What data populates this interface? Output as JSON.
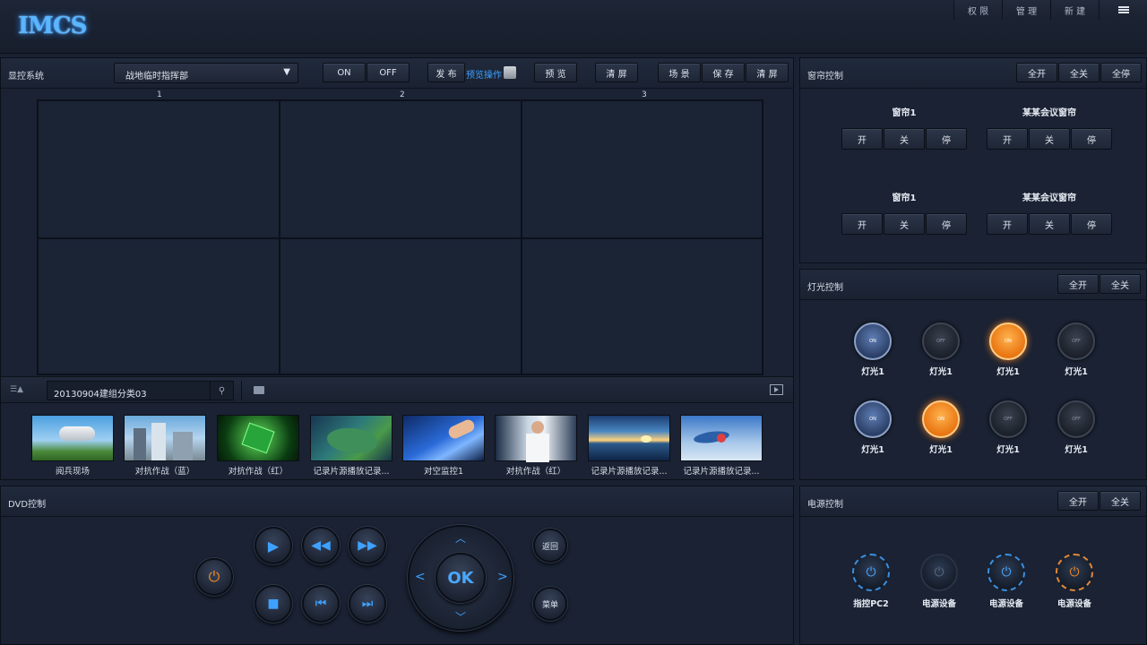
{
  "app": {
    "logo": "IMCS"
  },
  "topnav": [
    {
      "label": "权 限"
    },
    {
      "label": "管 理"
    },
    {
      "label": "新 建"
    }
  ],
  "display": {
    "title": "显控系统",
    "select_value": "战地临时指挥部",
    "on_label": "ON",
    "off_label": "OFF",
    "publish_label": "发 布",
    "preview_ops_label": "预览操作",
    "preview_label": "预 览",
    "clear_label": "清 屏",
    "scene_label": "场 景",
    "save_label": "保 存",
    "clear2_label": "清 屏",
    "columns": [
      "1",
      "2",
      "3"
    ],
    "search_value": "20130904建组分类03",
    "thumbnails": [
      {
        "label": "阅兵现场",
        "icon": "camera-scene"
      },
      {
        "label": "对抗作战（蓝）",
        "icon": "city-scene"
      },
      {
        "label": "对抗作战（红）",
        "icon": "chip-scene"
      },
      {
        "label": "记录片源播放记录...",
        "icon": "map-scene"
      },
      {
        "label": "对空监控1",
        "icon": "tablet-scene"
      },
      {
        "label": "对抗作战（红）",
        "icon": "doctor-scene"
      },
      {
        "label": "记录片源播放记录...",
        "icon": "sunset-scene"
      },
      {
        "label": "记录片源播放记录...",
        "icon": "particle-scene"
      }
    ]
  },
  "curtain": {
    "title": "窗帘控制",
    "all_open": "全开",
    "all_close": "全关",
    "all_stop": "全停",
    "groups": [
      {
        "name": "窗帘1",
        "open": "开",
        "close": "关",
        "stop": "停"
      },
      {
        "name": "某某会议窗帘",
        "open": "开",
        "close": "关",
        "stop": "停"
      },
      {
        "name": "窗帘1",
        "open": "开",
        "close": "关",
        "stop": "停"
      },
      {
        "name": "某某会议窗帘",
        "open": "开",
        "close": "关",
        "stop": "停"
      }
    ]
  },
  "light": {
    "title": "灯光控制",
    "all_open": "全开",
    "all_close": "全关",
    "lamps": [
      {
        "label": "灯光1",
        "state": "ON",
        "style": "on"
      },
      {
        "label": "灯光1",
        "state": "OFF",
        "style": "off"
      },
      {
        "label": "灯光1",
        "state": "ON",
        "style": "orange"
      },
      {
        "label": "灯光1",
        "state": "OFF",
        "style": "off"
      },
      {
        "label": "灯光1",
        "state": "ON",
        "style": "on"
      },
      {
        "label": "灯光1",
        "state": "ON",
        "style": "orange"
      },
      {
        "label": "灯光1",
        "state": "OFF",
        "style": "off"
      },
      {
        "label": "灯光1",
        "state": "OFF",
        "style": "off"
      }
    ]
  },
  "dvd": {
    "title": "DVD控制",
    "ok_label": "OK",
    "back_label": "返回",
    "menu_label": "菜单"
  },
  "power": {
    "title": "电源控制",
    "all_open": "全开",
    "all_close": "全关",
    "devices": [
      {
        "label": "指控PC2",
        "ring": "#3a8fe0"
      },
      {
        "label": "电源设备",
        "ring": "#2a3344"
      },
      {
        "label": "电源设备",
        "ring": "#3a8fe0"
      },
      {
        "label": "电源设备",
        "ring": "#e0883a"
      }
    ]
  },
  "colors": {
    "accent": "#3ea1ff",
    "orange": "#f08a24",
    "bg": "#1a2232"
  }
}
